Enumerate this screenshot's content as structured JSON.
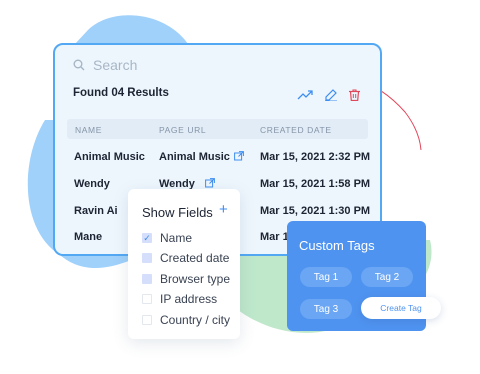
{
  "colors": {
    "accent": "#3d8ef0",
    "delete": "#e0485b",
    "border": "#53a8f3",
    "panel": "#4f93f0"
  },
  "search": {
    "placeholder": "Search"
  },
  "results": {
    "summary": "Found 04 Results"
  },
  "toolbar": {
    "icons": [
      "trending-up-icon",
      "edit-icon",
      "trash-icon"
    ]
  },
  "table": {
    "columns": [
      "NAME",
      "PAGE URL",
      "CREATED DATE"
    ],
    "rows": [
      {
        "name": "Animal Music",
        "page_url": "Animal Music",
        "created": "Mar 15, 2021 2:32 PM"
      },
      {
        "name": "Wendy",
        "page_url": "Wendy",
        "created": "Mar 15, 2021 1:58 PM"
      },
      {
        "name": "Ravin Ai",
        "page_url": "",
        "created": "Mar 15, 2021 1:30 PM"
      },
      {
        "name": "Mane",
        "page_url": "",
        "created": "Mar 1"
      }
    ]
  },
  "show_fields": {
    "title": "Show Fields",
    "add_symbol": "+",
    "items": [
      {
        "label": "Name",
        "checked": true
      },
      {
        "label": "Created date",
        "checked": false
      },
      {
        "label": "Browser type",
        "checked": false
      },
      {
        "label": "IP address",
        "checked": false
      },
      {
        "label": "Country / city",
        "checked": false
      }
    ]
  },
  "custom_tags": {
    "title": "Custom Tags",
    "tags": [
      "Tag 1",
      "Tag 2",
      "Tag 3"
    ],
    "create_label": "Create Tag"
  }
}
